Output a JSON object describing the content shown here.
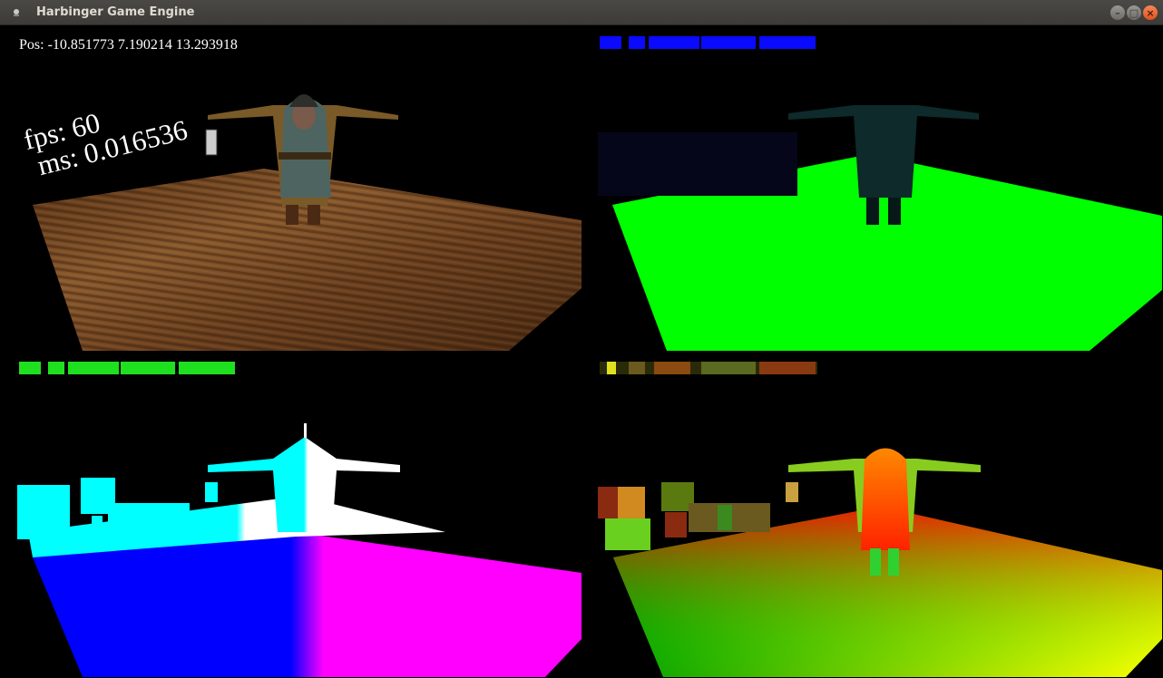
{
  "window": {
    "title": "Harbinger Game Engine",
    "buttons": {
      "minimize": "–",
      "maximize": "□",
      "close": "×"
    }
  },
  "overlay": {
    "position": "Pos: -10.851773 7.190214 13.293918",
    "fps": "fps: 60",
    "ms": "ms: 0.016536"
  },
  "colors": {
    "titlebar": "#3c3b37",
    "normal_floor": "#00ff00",
    "normal_cyan": "#00ffff",
    "normal_blue": "#0000ff",
    "normal_magenta": "#ff00ff",
    "garble_blue": "#0a0aff",
    "garble_green": "#1fe01f"
  },
  "icons": [
    "app-icon",
    "minimize-icon",
    "maximize-icon",
    "close-icon"
  ]
}
